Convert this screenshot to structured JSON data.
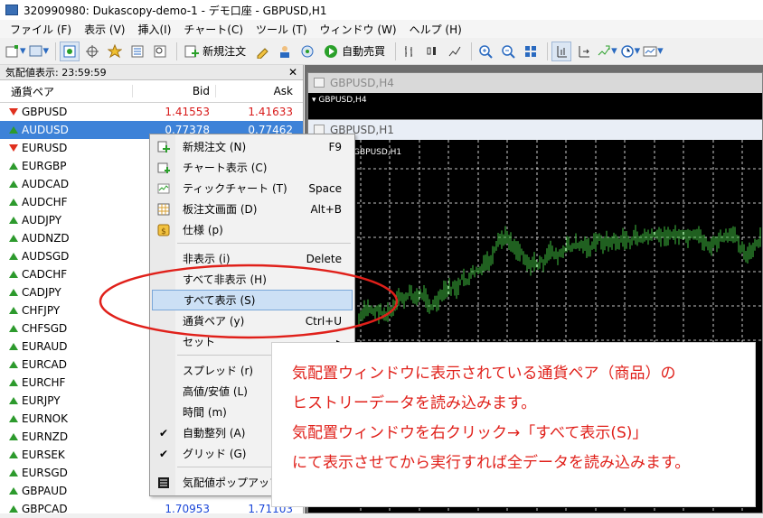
{
  "window": {
    "title": "320990980: Dukascopy-demo-1 - デモ口座 - GBPUSD,H1"
  },
  "menu": [
    "ファイル (F)",
    "表示 (V)",
    "挿入(I)",
    "チャート(C)",
    "ツール (T)",
    "ウィンドウ (W)",
    "ヘルプ (H)"
  ],
  "toolbar": {
    "new_order": "新規注文",
    "auto_trading": "自動売買"
  },
  "market_watch": {
    "header": "気配値表示: 23:59:59",
    "columns": {
      "symbol": "通貨ペア",
      "bid": "Bid",
      "ask": "Ask"
    },
    "rows": [
      {
        "sym": "GBPUSD",
        "dir": "down",
        "bid": "1.41553",
        "ask": "1.41633",
        "color": "red"
      },
      {
        "sym": "AUDUSD",
        "dir": "up",
        "bid": "0.77378",
        "ask": "0.77462",
        "color": "sel"
      },
      {
        "sym": "EURUSD",
        "dir": "down",
        "bid": "",
        "ask": "",
        "color": ""
      },
      {
        "sym": "EURGBP",
        "dir": "up",
        "bid": "",
        "ask": "",
        "color": ""
      },
      {
        "sym": "AUDCAD",
        "dir": "up",
        "bid": "",
        "ask": "",
        "color": ""
      },
      {
        "sym": "AUDCHF",
        "dir": "up",
        "bid": "",
        "ask": "",
        "color": ""
      },
      {
        "sym": "AUDJPY",
        "dir": "up",
        "bid": "",
        "ask": "",
        "color": ""
      },
      {
        "sym": "AUDNZD",
        "dir": "up",
        "bid": "",
        "ask": "",
        "color": ""
      },
      {
        "sym": "AUDSGD",
        "dir": "up",
        "bid": "",
        "ask": "",
        "color": ""
      },
      {
        "sym": "CADCHF",
        "dir": "up",
        "bid": "",
        "ask": "",
        "color": ""
      },
      {
        "sym": "CADJPY",
        "dir": "up",
        "bid": "",
        "ask": "",
        "color": ""
      },
      {
        "sym": "CHFJPY",
        "dir": "up",
        "bid": "",
        "ask": "",
        "color": ""
      },
      {
        "sym": "CHFSGD",
        "dir": "up",
        "bid": "",
        "ask": "",
        "color": ""
      },
      {
        "sym": "EURAUD",
        "dir": "up",
        "bid": "",
        "ask": "",
        "color": ""
      },
      {
        "sym": "EURCAD",
        "dir": "up",
        "bid": "",
        "ask": "",
        "color": ""
      },
      {
        "sym": "EURCHF",
        "dir": "up",
        "bid": "",
        "ask": "",
        "color": ""
      },
      {
        "sym": "EURJPY",
        "dir": "up",
        "bid": "",
        "ask": "",
        "color": ""
      },
      {
        "sym": "EURNOK",
        "dir": "up",
        "bid": "",
        "ask": "",
        "color": ""
      },
      {
        "sym": "EURNZD",
        "dir": "up",
        "bid": "",
        "ask": "",
        "color": ""
      },
      {
        "sym": "EURSEK",
        "dir": "up",
        "bid": "",
        "ask": "",
        "color": ""
      },
      {
        "sym": "EURSGD",
        "dir": "up",
        "bid": "",
        "ask": "",
        "color": ""
      },
      {
        "sym": "GBPAUD",
        "dir": "up",
        "bid": "",
        "ask": "",
        "color": ""
      },
      {
        "sym": "GBPCAD",
        "dir": "up",
        "bid": "1.70953",
        "ask": "1.71103",
        "color": "blue"
      }
    ]
  },
  "charts": {
    "back_title": "GBPUSD,H4",
    "back_inner": "GBPUSD,H4",
    "front_title": "GBPUSD,H1",
    "front_inner": "GBPUSD,H1"
  },
  "context_menu": {
    "items": [
      {
        "label": "新規注文 (N)",
        "shortcut": "F9",
        "icon": "new-order-icon"
      },
      {
        "label": "チャート表示 (C)",
        "shortcut": "",
        "icon": "chart-window-icon"
      },
      {
        "label": "ティックチャート (T)",
        "shortcut": "Space",
        "icon": "tick-chart-icon"
      },
      {
        "label": "板注文画面 (D)",
        "shortcut": "Alt+B",
        "icon": "depth-of-market-icon"
      },
      {
        "label": "仕様 (p)",
        "shortcut": "",
        "icon": "specification-icon"
      },
      {
        "label": "非表示 (i)",
        "shortcut": "Delete",
        "icon": ""
      },
      {
        "label": "すべて非表示 (H)",
        "shortcut": "",
        "icon": ""
      },
      {
        "label": "すべて表示 (S)",
        "shortcut": "",
        "icon": ""
      },
      {
        "label": "通貨ペア (y)",
        "shortcut": "Ctrl+U",
        "icon": ""
      },
      {
        "label": "セット",
        "shortcut": "▸",
        "icon": ""
      },
      {
        "label": "スプレッド (r)",
        "shortcut": "",
        "icon": ""
      },
      {
        "label": "高値/安値 (L)",
        "shortcut": "",
        "icon": ""
      },
      {
        "label": "時間 (m)",
        "shortcut": "",
        "icon": ""
      },
      {
        "label": "自動整列 (A)",
        "shortcut": "",
        "icon": "check-icon"
      },
      {
        "label": "グリッド (G)",
        "shortcut": "",
        "icon": "check-icon"
      },
      {
        "label": "気配値ポップアップ表",
        "shortcut": "",
        "icon": "popup-prices-icon"
      }
    ]
  },
  "annotation": {
    "lines": [
      "気配置ウィンドウに表示されている通貨ペア（商品）の",
      "ヒストリーデータを読み込みます。",
      "気配置ウィンドウを右クリック→「すべて表示(S)」",
      "にて表示させてから実行すれば全データを読み込みます。"
    ]
  },
  "colors": {
    "accent_red": "#e0201a",
    "selection": "#3d82d8",
    "bull": "#2d9a2d",
    "bear": "#e0301e"
  }
}
